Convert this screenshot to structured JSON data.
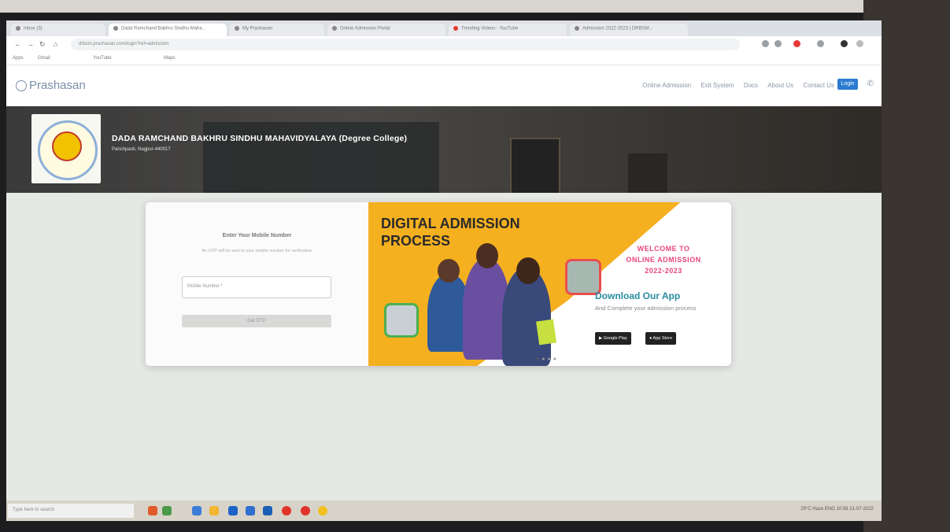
{
  "browser": {
    "tabs": [
      {
        "label": "Inbox (3)"
      },
      {
        "label": "Dada Ramchand Bakhru Sindhu Maha..."
      },
      {
        "label": "My Prashasan"
      },
      {
        "label": "Online Admission Portal"
      },
      {
        "label": "Trending Videos - YouTube"
      },
      {
        "label": "Admission 2022-2023 | DRBSM..."
      }
    ],
    "url": "drbsm.prashasan.com/login?ref=admission",
    "bookmarks": [
      "Apps",
      "Gmail",
      "YouTube",
      "Maps"
    ]
  },
  "site": {
    "brand": "Prashasan",
    "nav": [
      "Online Admission",
      "Exit System",
      "Docs",
      "About Us",
      "Contact Us"
    ],
    "login_label": "Login"
  },
  "college": {
    "name": "DADA RAMCHAND BAKHRU SINDHU MAHAVIDYALAYA (Degree College)",
    "address": "Panchpaoli, Nagpur-440017"
  },
  "login_form": {
    "title": "Enter Your Mobile Number",
    "description": "An OTP will be sent to your mobile number for verification",
    "input_placeholder": "Mobile Number *",
    "button_label": "Get OTP"
  },
  "promo": {
    "title_line1": "DIGITAL ADMISSION",
    "title_line2": "PROCESS",
    "welcome_line1": "WELCOME TO",
    "welcome_line2": "ONLINE ADMISSION",
    "welcome_line3": "2022-2023",
    "download_title": "Download Our App",
    "download_sub": "And Complete your admission process",
    "google_play": "Google Play",
    "app_store": "App Store"
  },
  "taskbar": {
    "search_placeholder": "Type here to search",
    "tray_text": "29°C Haze   ENG   10:58   21-07-2022"
  }
}
